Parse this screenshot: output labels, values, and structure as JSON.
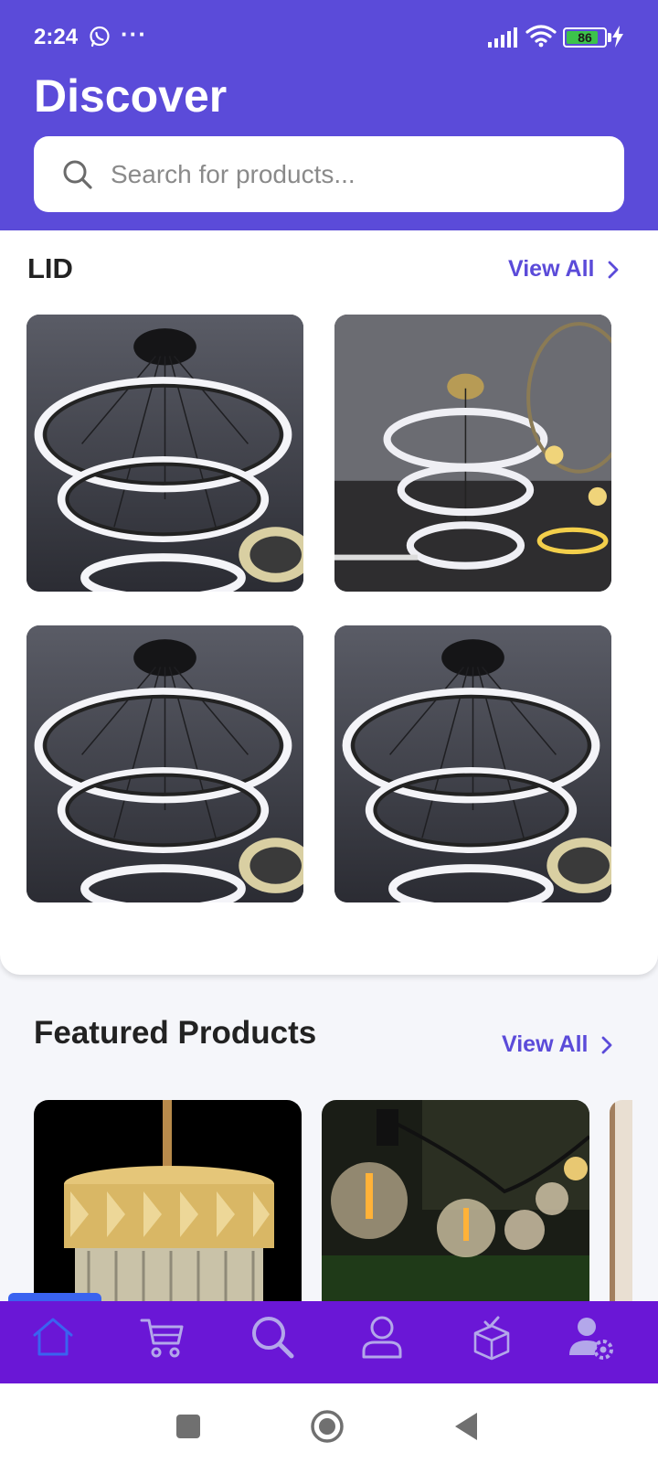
{
  "status": {
    "time": "2:24",
    "overflow": "···",
    "battery": "86",
    "battery_level": 0.86
  },
  "header": {
    "title": "Discover",
    "search_placeholder": "Search for products..."
  },
  "lid_section": {
    "title": "LID",
    "view_all": "View All",
    "items": [
      {
        "image": "ring-chandelier"
      },
      {
        "image": "tiered-ring-chandelier"
      },
      {
        "image": "ring-chandelier"
      },
      {
        "image": "ring-chandelier"
      }
    ]
  },
  "featured": {
    "title": "Featured Products",
    "view_all": "View All",
    "items": [
      {
        "image": "crystal-drum-chandelier"
      },
      {
        "image": "string-bulb-lights"
      },
      {
        "image": "partial-product"
      }
    ]
  },
  "bottom_nav": {
    "items": [
      "home-icon",
      "cart-icon",
      "search-icon",
      "profile-icon",
      "package-icon",
      "account-settings-icon"
    ],
    "active": "home-icon"
  },
  "colors": {
    "header": "#5b4bd9",
    "accent": "#5b4bd9",
    "nav_bg": "#6a17d6",
    "nav_active": "#3a63f0",
    "nav_icon": "#b3a7ea"
  }
}
